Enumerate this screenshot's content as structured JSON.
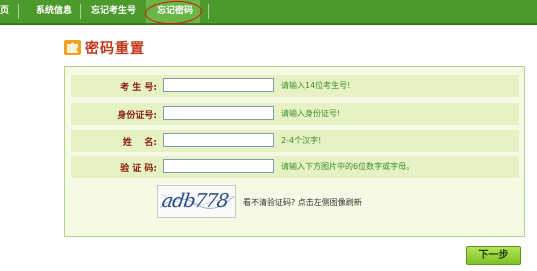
{
  "nav": {
    "items": [
      {
        "label": "页"
      },
      {
        "label": "系统信息"
      },
      {
        "label": "忘记考生号"
      },
      {
        "label": "忘记密码"
      }
    ],
    "active_index": 3
  },
  "page_title": "密码重置",
  "form": {
    "rows": [
      {
        "label": "考 生 号:",
        "value": "",
        "hint": "请输入14位考生号!"
      },
      {
        "label": "身份证号:",
        "value": "",
        "hint": "请输入身份证号!"
      },
      {
        "label": "姓    名:",
        "value": "",
        "hint": "2-4个汉字!"
      },
      {
        "label": "验 证 码:",
        "value": "",
        "hint": "请输入下方图片中的6位数字或字母。"
      }
    ],
    "captcha_image_text": "adb778",
    "captcha_refresh_text": "看不清验证码? 点击左侧图像刷新"
  },
  "next_button_label": "下一步",
  "colors": {
    "nav_bg": "#4d9a2c",
    "title": "#c0391b",
    "highlight_ellipse": "#d4140b"
  }
}
